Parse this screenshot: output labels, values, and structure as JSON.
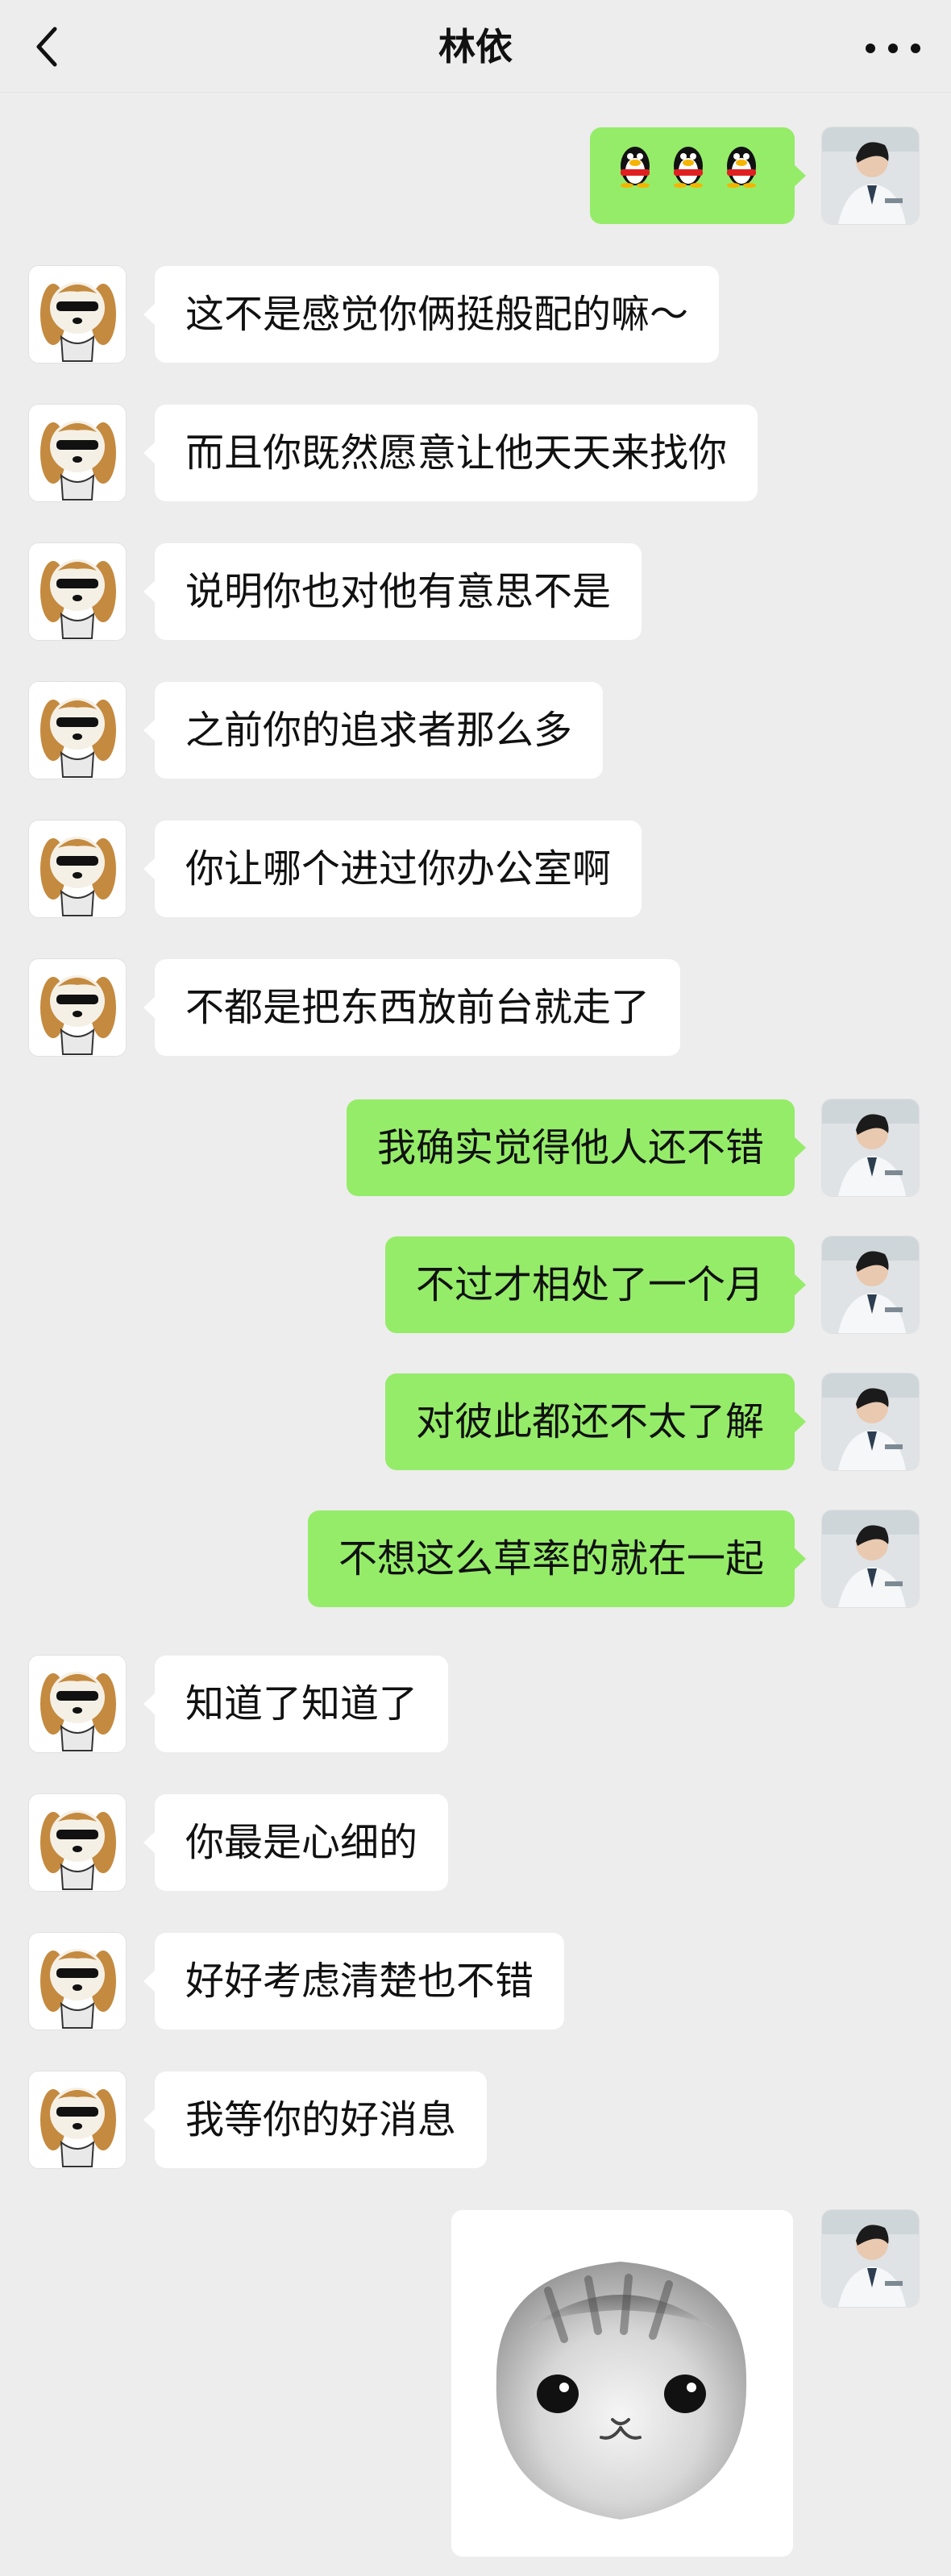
{
  "header": {
    "title": "林依",
    "back_icon": "back-chevron-icon",
    "more_icon": "more-dots-icon"
  },
  "messages": [
    {
      "from": "me",
      "type": "emoji",
      "icons": [
        "qq-penguin-icon",
        "qq-penguin-icon",
        "qq-penguin-icon"
      ]
    },
    {
      "from": "them",
      "text": "这不是感觉你俩挺般配的嘛～"
    },
    {
      "from": "them",
      "text": "而且你既然愿意让他天天来找你"
    },
    {
      "from": "them",
      "text": "说明你也对他有意思不是"
    },
    {
      "from": "them",
      "text": "之前你的追求者那么多"
    },
    {
      "from": "them",
      "text": "你让哪个进过你办公室啊"
    },
    {
      "from": "them",
      "text": "不都是把东西放前台就走了"
    },
    {
      "from": "me",
      "text": "我确实觉得他人还不错"
    },
    {
      "from": "me",
      "text": "不过才相处了一个月"
    },
    {
      "from": "me",
      "text": "对彼此都还不太了解"
    },
    {
      "from": "me",
      "text": "不想这么草率的就在一起"
    },
    {
      "from": "them",
      "text": "知道了知道了"
    },
    {
      "from": "them",
      "text": "你最是心细的"
    },
    {
      "from": "them",
      "text": "好好考虑清楚也不错"
    },
    {
      "from": "them",
      "text": "我等你的好消息"
    },
    {
      "from": "me",
      "type": "sticker",
      "sticker": "cat-face-sticker"
    }
  ],
  "colors": {
    "background": "#ededed",
    "bubble_in": "#ffffff",
    "bubble_out": "#95ec69",
    "text": "#111111"
  }
}
